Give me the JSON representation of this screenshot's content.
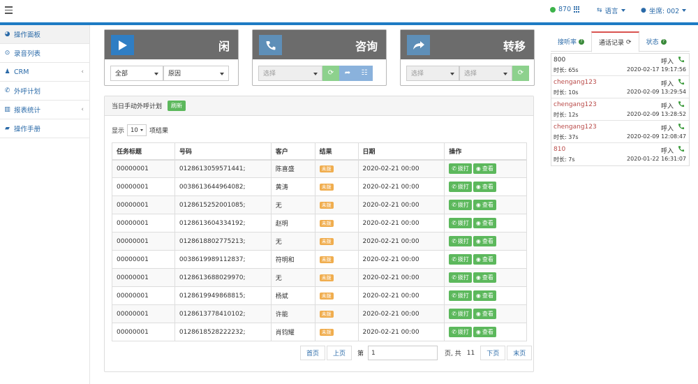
{
  "topbar": {
    "count": "870",
    "language_label": "语言",
    "seat_label": "坐席: 002"
  },
  "sidebar": {
    "items": [
      {
        "label": "操作面板",
        "icon": "dashboard-icon"
      },
      {
        "label": "录音列表",
        "icon": "record-icon"
      },
      {
        "label": "CRM",
        "icon": "person-icon"
      },
      {
        "label": "外呼计划",
        "icon": "phone-icon"
      },
      {
        "label": "报表统计",
        "icon": "bar-chart-icon"
      },
      {
        "label": "操作手册",
        "icon": "book-icon"
      }
    ]
  },
  "panels": {
    "idle": {
      "title": "闲",
      "select1": "全部",
      "select2": "原因"
    },
    "consult": {
      "title": "咨询",
      "select1": "选择"
    },
    "transfer": {
      "title": "转移",
      "select1": "选择",
      "select2": "选择"
    }
  },
  "task_box": {
    "title": "当日手动外呼计划",
    "refresh_label": "刷新",
    "show_label": "显示",
    "page_length": "10",
    "items_label": "项结果",
    "columns": [
      "任务标题",
      "号码",
      "客户",
      "结果",
      "日期",
      "操作"
    ],
    "rows": [
      {
        "title": "00000001",
        "number": "0128613059571441;",
        "customer": "陈喜盛",
        "result": "未拨",
        "date": "2020-02-21 00:00"
      },
      {
        "title": "00000001",
        "number": "0038613644964082;",
        "customer": "黄涛",
        "result": "未拨",
        "date": "2020-02-21 00:00"
      },
      {
        "title": "00000001",
        "number": "0128615252001085;",
        "customer": "无",
        "result": "未拨",
        "date": "2020-02-21 00:00"
      },
      {
        "title": "00000001",
        "number": "0128613604334192;",
        "customer": "赵明",
        "result": "未拨",
        "date": "2020-02-21 00:00"
      },
      {
        "title": "00000001",
        "number": "0128618802775213;",
        "customer": "无",
        "result": "未拨",
        "date": "2020-02-21 00:00"
      },
      {
        "title": "00000001",
        "number": "0038619989112837;",
        "customer": "符明和",
        "result": "未拨",
        "date": "2020-02-21 00:00"
      },
      {
        "title": "00000001",
        "number": "0128613688029970;",
        "customer": "无",
        "result": "未拨",
        "date": "2020-02-21 00:00"
      },
      {
        "title": "00000001",
        "number": "0128619949868815;",
        "customer": "杨斌",
        "result": "未拨",
        "date": "2020-02-21 00:00"
      },
      {
        "title": "00000001",
        "number": "0128613778410102;",
        "customer": "许能",
        "result": "未拨",
        "date": "2020-02-21 00:00"
      },
      {
        "title": "00000001",
        "number": "0128618528222232;",
        "customer": "肖钧耀",
        "result": "未拨",
        "date": "2020-02-21 00:00"
      }
    ],
    "dial_label": "拨打",
    "view_label": "查看",
    "pager": {
      "first": "首页",
      "prev": "上页",
      "page_prefix": "第",
      "current_page": "1",
      "page_suffix": "页, 共",
      "total_pages": "11",
      "next": "下页",
      "last": "末页"
    }
  },
  "right": {
    "tabs": [
      "接听率",
      "通话记录",
      "状态"
    ],
    "calls": [
      {
        "number": "800",
        "direction": "呼入",
        "duration": "时长: 65s",
        "time": "2020-02-17 19:17:56",
        "highlight": false
      },
      {
        "number": "chengang123",
        "direction": "呼入",
        "duration": "时长: 10s",
        "time": "2020-02-09 13:29:54",
        "highlight": true
      },
      {
        "number": "chengang123",
        "direction": "呼入",
        "duration": "时长: 12s",
        "time": "2020-02-09 13:28:52",
        "highlight": true
      },
      {
        "number": "chengang123",
        "direction": "呼入",
        "duration": "时长: 37s",
        "time": "2020-02-09 12:08:47",
        "highlight": true
      },
      {
        "number": "810",
        "direction": "呼入",
        "duration": "时长: 7s",
        "time": "2020-01-22 16:31:07",
        "highlight": true
      }
    ]
  }
}
